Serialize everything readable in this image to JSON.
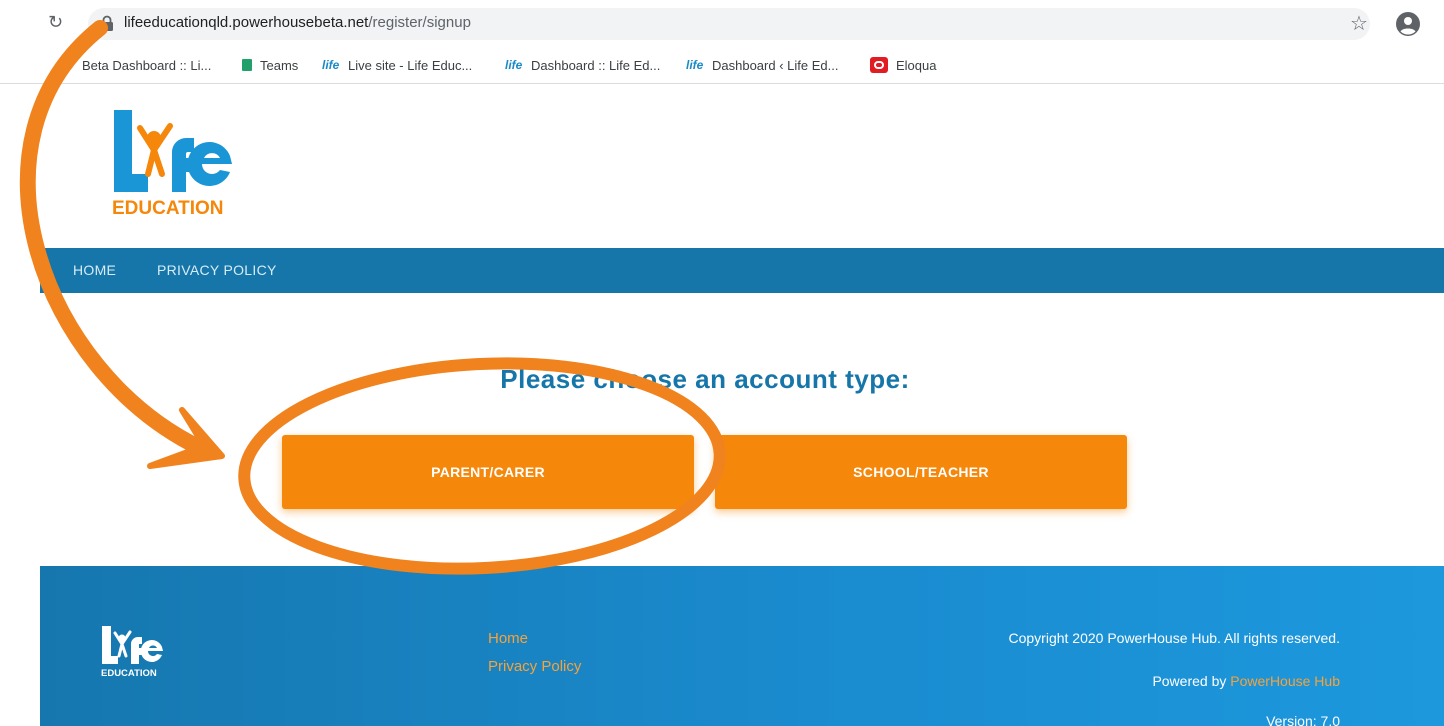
{
  "browser": {
    "url_domain": "lifeeducationqld.powerhousebeta.net",
    "url_path": "/register/signup",
    "bookmarks": [
      {
        "label": "Beta Dashboard :: Li...",
        "icon": "life-education-favicon"
      },
      {
        "label": "Teams",
        "icon": "teams-favicon"
      },
      {
        "label": "Live site - Life Educ...",
        "icon": "life-education-favicon"
      },
      {
        "label": "Dashboard :: Life Ed...",
        "icon": "life-education-favicon"
      },
      {
        "label": "Dashboard ‹ Life Ed...",
        "icon": "life-education-favicon"
      },
      {
        "label": "Eloqua",
        "icon": "eloqua-favicon"
      }
    ]
  },
  "site": {
    "logo_word": "life",
    "logo_sub": "EDUCATION"
  },
  "nav": {
    "items": [
      "HOME",
      "PRIVACY POLICY"
    ]
  },
  "main": {
    "heading": "Please choose an account type:",
    "buttons": [
      "PARENT/CARER",
      "SCHOOL/TEACHER"
    ]
  },
  "footer": {
    "links": [
      "Home",
      "Privacy Policy"
    ],
    "copyright": "Copyright 2020 PowerHouse Hub. All rights reserved.",
    "powered_prefix": "Powered by",
    "powered_link": "PowerHouse Hub",
    "version": "Version: 7.0"
  },
  "colors": {
    "brand_blue": "#1676a9",
    "brand_orange": "#f5870a",
    "annotation_orange": "#f0831e"
  }
}
